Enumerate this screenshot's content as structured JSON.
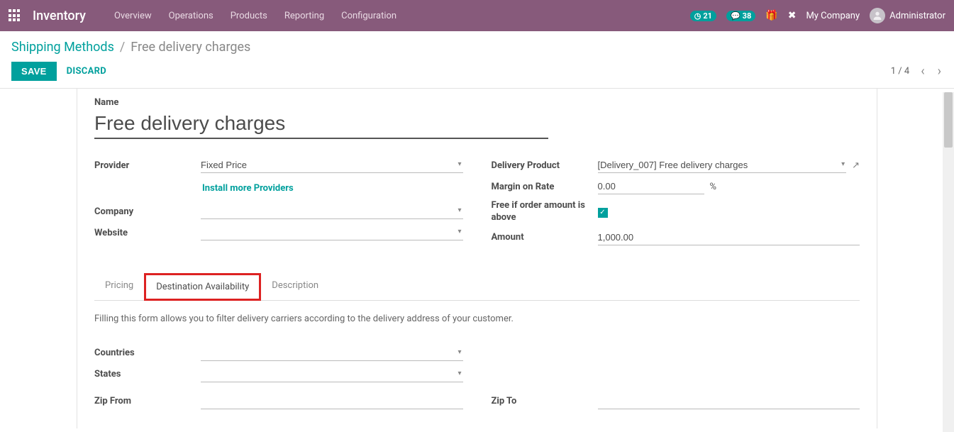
{
  "navbar": {
    "brand": "Inventory",
    "menu": [
      "Overview",
      "Operations",
      "Products",
      "Reporting",
      "Configuration"
    ],
    "badge1": "21",
    "badge2": "38",
    "company": "My Company",
    "user": "Administrator"
  },
  "breadcrumb": {
    "parent": "Shipping Methods",
    "current": "Free delivery charges"
  },
  "actions": {
    "save": "SAVE",
    "discard": "DISCARD",
    "pager": "1 / 4"
  },
  "form": {
    "name_label": "Name",
    "name_value": "Free delivery charges",
    "left": {
      "provider_label": "Provider",
      "provider_value": "Fixed Price",
      "install_link": "Install more Providers",
      "company_label": "Company",
      "company_value": "",
      "website_label": "Website",
      "website_value": ""
    },
    "right": {
      "delivery_product_label": "Delivery Product",
      "delivery_product_value": "[Delivery_007] Free delivery charges",
      "margin_label": "Margin on Rate",
      "margin_value": "0.00",
      "margin_suffix": "%",
      "free_label": "Free if order amount is above",
      "amount_label": "Amount",
      "amount_value": "1,000.00"
    }
  },
  "tabs": {
    "pricing": "Pricing",
    "dest": "Destination Availability",
    "desc": "Description",
    "dest_text": "Filling this form allows you to filter delivery carriers according to the delivery address of your customer.",
    "countries_label": "Countries",
    "states_label": "States",
    "zipfrom_label": "Zip From",
    "zipto_label": "Zip To"
  }
}
